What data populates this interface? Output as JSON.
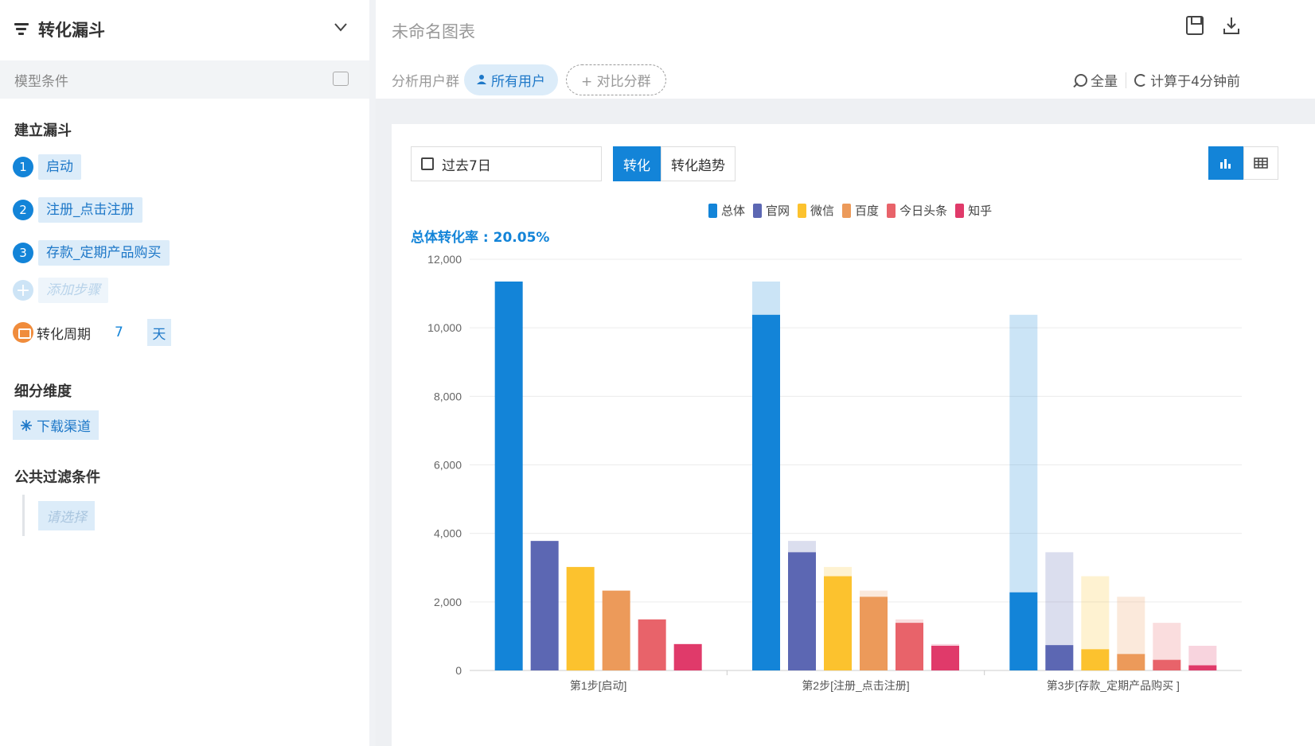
{
  "left_panel": {
    "title": "转化漏斗",
    "model_condition": "模型条件",
    "build_funnel_title": "建立漏斗",
    "steps": [
      {
        "num": "1",
        "label": "启动"
      },
      {
        "num": "2",
        "label": "注册_点击注册"
      },
      {
        "num": "3",
        "label": "存款_定期产品购买"
      }
    ],
    "add_step": "添加步骤",
    "period": {
      "label": "转化周期",
      "value": "7",
      "unit": "天"
    },
    "dimension_title": "细分维度",
    "dimension_value": "下载渠道",
    "filter_title": "公共过滤条件",
    "filter_placeholder": "请选择"
  },
  "header": {
    "chart_title": "未命名图表",
    "segment_label": "分析用户群",
    "segment_all": "所有用户",
    "segment_compare": "+ 对比分群",
    "scope": "全量",
    "computed": "计算于4分钟前"
  },
  "toolbar": {
    "date_range": "过去7日",
    "tab_conversion": "转化",
    "tab_trend": "转化趋势"
  },
  "rate_text": "总体转化率 : 20.05%",
  "colors": {
    "accent": "#1384d8",
    "series": [
      "#1384d8",
      "#5c67b3",
      "#fcc22e",
      "#ec9a5a",
      "#e8636a",
      "#e03a6a"
    ]
  },
  "chart_data": {
    "type": "bar",
    "categories": [
      "第1步[启动]",
      "第2步[注册_点击注册]",
      "第3步[存款_定期产品购买 ]"
    ],
    "series": [
      {
        "name": "总体",
        "values": [
          11350,
          10380,
          2280
        ],
        "lost": [
          0,
          970,
          8100
        ]
      },
      {
        "name": "官网",
        "values": [
          3780,
          3450,
          740
        ],
        "lost": [
          0,
          330,
          2710
        ]
      },
      {
        "name": "微信",
        "values": [
          3020,
          2750,
          620
        ],
        "lost": [
          0,
          270,
          2130
        ]
      },
      {
        "name": "百度",
        "values": [
          2330,
          2150,
          480
        ],
        "lost": [
          0,
          180,
          1670
        ]
      },
      {
        "name": "今日头条",
        "values": [
          1490,
          1390,
          310
        ],
        "lost": [
          0,
          100,
          1080
        ]
      },
      {
        "name": "知乎",
        "values": [
          770,
          720,
          150
        ],
        "lost": [
          0,
          50,
          570
        ]
      }
    ],
    "yticks": [
      "0",
      "2,000",
      "4,000",
      "6,000",
      "8,000",
      "10,000",
      "12,000"
    ],
    "ylim": [
      0,
      12000
    ],
    "grid": true,
    "legend": "top-center"
  }
}
